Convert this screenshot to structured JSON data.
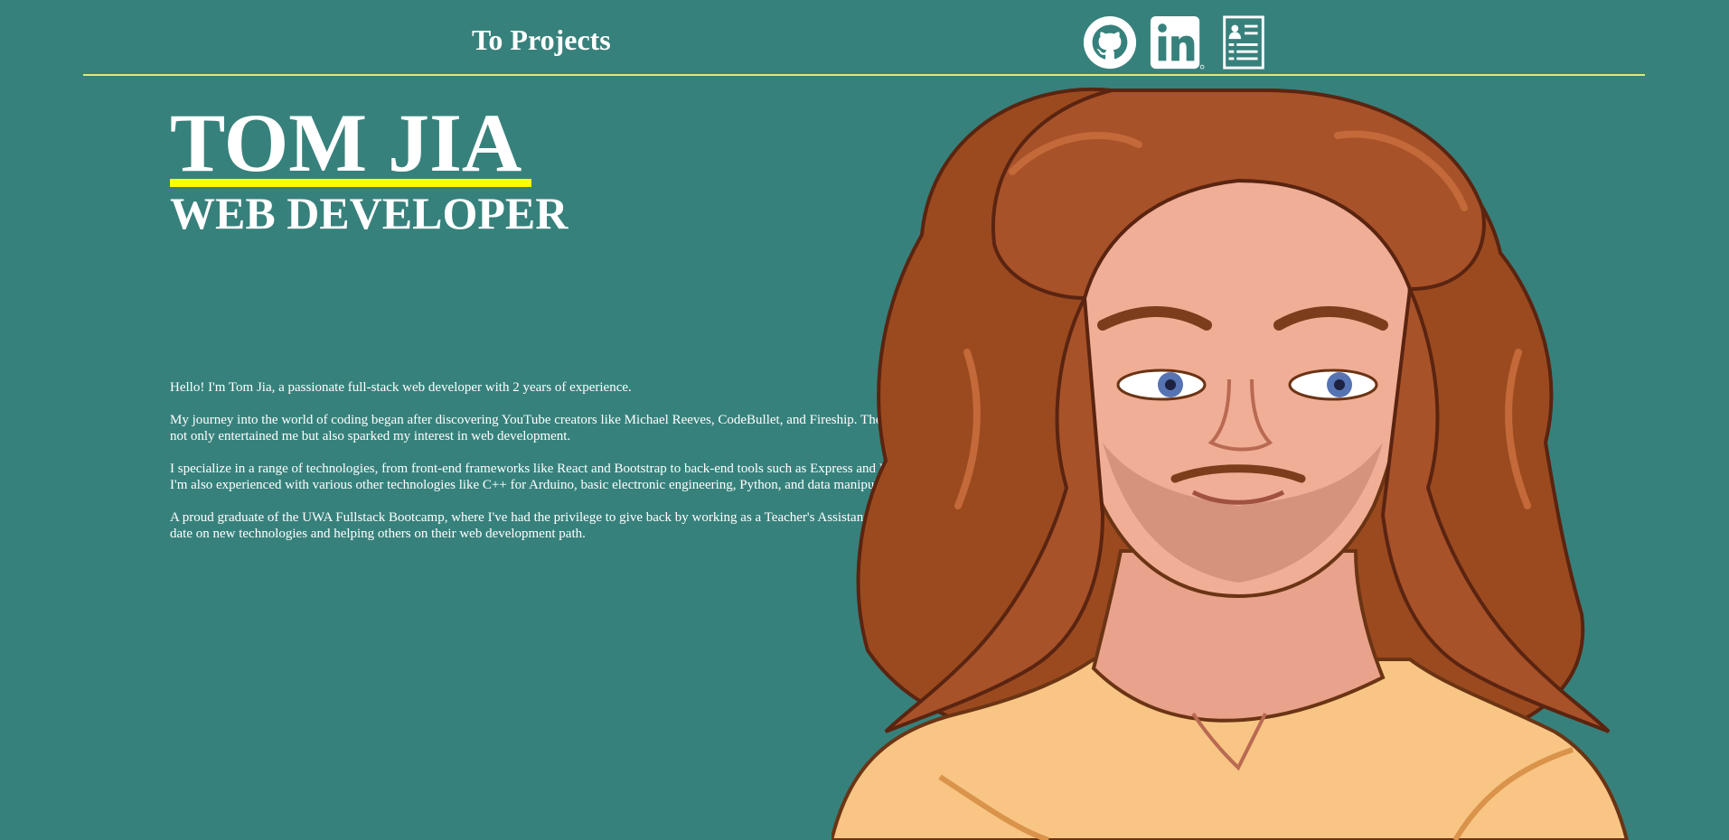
{
  "nav": {
    "projects_link": "To Projects",
    "social": [
      {
        "icon": "github-icon"
      },
      {
        "icon": "linkedin-icon"
      },
      {
        "icon": "resume-icon"
      }
    ]
  },
  "hero": {
    "name": "TOM JIA",
    "role": "WEB DEVELOPER"
  },
  "about": {
    "paragraphs": [
      "Hello! I'm Tom Jia, a passionate full-stack web developer with 2 years of experience.",
      "My journey into the world of coding began after discovering YouTube creators like Michael Reeves, CodeBullet, and Fireship. Their content not only entertained me but also sparked my interest in web development.",
      "I specialize in a range of technologies, from front-end frameworks like React and Bootstrap to back-end tools such as Express and MongoDB. I'm also experienced with various other technologies like C++ for Arduino, basic electronic engineering, Python, and data manipulation.",
      "A proud graduate of the UWA Fullstack Bootcamp, where I've had the privilege to give back by working as a Teacher's Assistant, keeping up to date on new technologies and helping others on their web development path."
    ]
  },
  "colors": {
    "background": "#37817c",
    "accent_underline": "#ffff00",
    "divider": "#dfe97e",
    "text": "#ffffff"
  }
}
